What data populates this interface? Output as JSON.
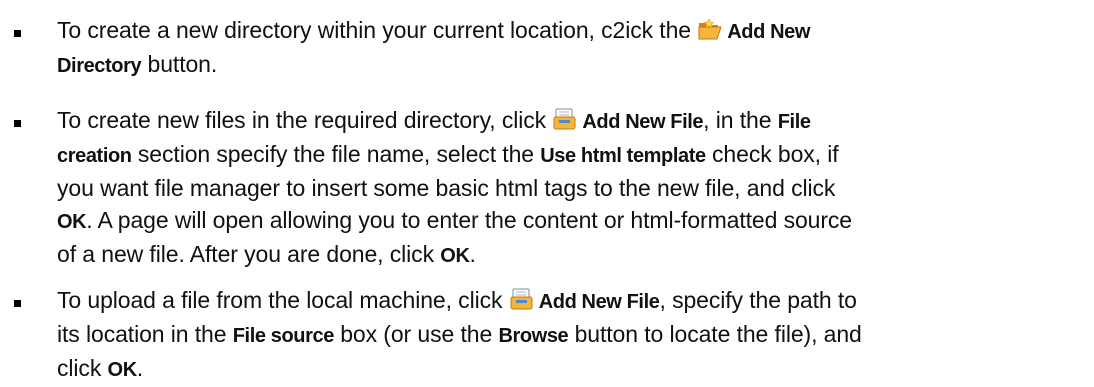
{
  "items": [
    {
      "pre": "To create a new directory within your current location, c2ick the",
      "icon": "folder-open-icon",
      "bold1": "Add New",
      "bold2": "Directory",
      "post": "button."
    },
    {
      "l1_pre": "To create new files in the required directory, click",
      "icon": "add-file-icon",
      "l1_bold": "Add New File",
      "l1_mid": ", in the",
      "l1_bold2": "File",
      "l2_bold": "creation",
      "l2_mid": "section specify the file name, select the",
      "l2_bold2": "Use html template",
      "l2_post": "check box, if",
      "l3": "you want file manager to insert some basic html tags to the new file, and click",
      "l4_bold": "OK",
      "l4_post": ". A page will open allowing you to enter the content or html-formatted source",
      "l5_pre": "of a new file. After you are done, click",
      "l5_bold": "OK",
      "l5_post": "."
    },
    {
      "l1_pre": "To upload a file from the local machine, click",
      "icon": "add-file-icon",
      "l1_bold": "Add New File",
      "l1_post": ", specify the path to",
      "l2_pre": "its location in the",
      "l2_bold": "File source",
      "l2_mid": "box (or use the",
      "l2_bold2": "Browse",
      "l2_post": "button to locate the file), and",
      "l3_pre": "click",
      "l3_bold": "OK",
      "l3_post": "."
    }
  ],
  "colors": {
    "text": "#111111",
    "folder_yellow": "#f3b63a",
    "folder_orange": "#e07a1e",
    "file_blue": "#4f89c9"
  }
}
